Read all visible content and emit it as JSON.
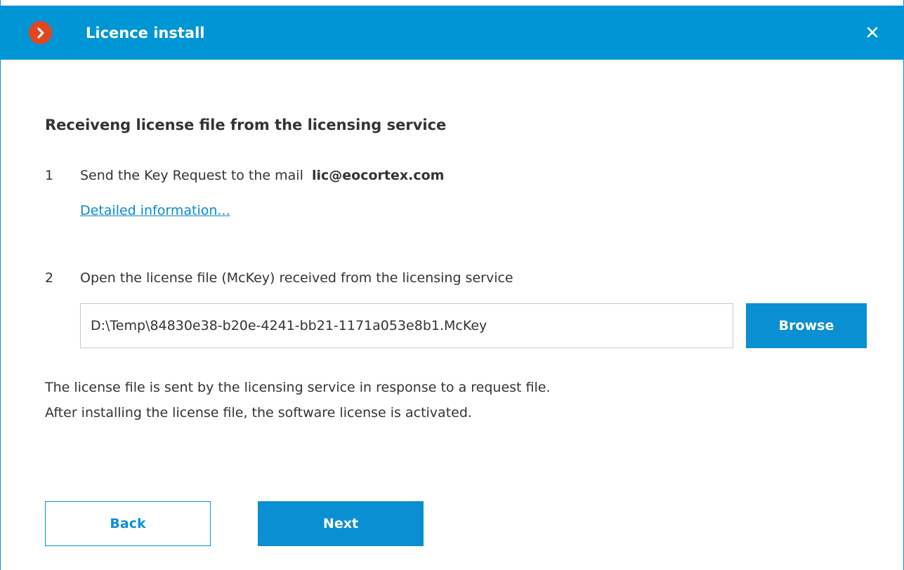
{
  "window": {
    "title": "Licence install",
    "accent_color": "#0095d5",
    "logo_color": "#e2461d",
    "logo_icon": "chevron-right-icon",
    "close_icon": "close-icon"
  },
  "content": {
    "heading": "Receiveng license file from the licensing service",
    "step1": {
      "number": "1",
      "text": "Send the Key Request to the mail",
      "email": "lic@eocortex.com",
      "link_label": "Detailed information..."
    },
    "step2": {
      "number": "2",
      "text": "Open the license file (McKey) received from the licensing service",
      "file_path": "D:\\Temp\\84830e38-b20e-4241-bb21-1171a053e8b1.McKey",
      "browse_label": "Browse"
    },
    "info_line1": "The license file is sent by the licensing service in response to a request file.",
    "info_line2": "After installing the license file, the software license is activated."
  },
  "footer": {
    "back_label": "Back",
    "next_label": "Next"
  }
}
